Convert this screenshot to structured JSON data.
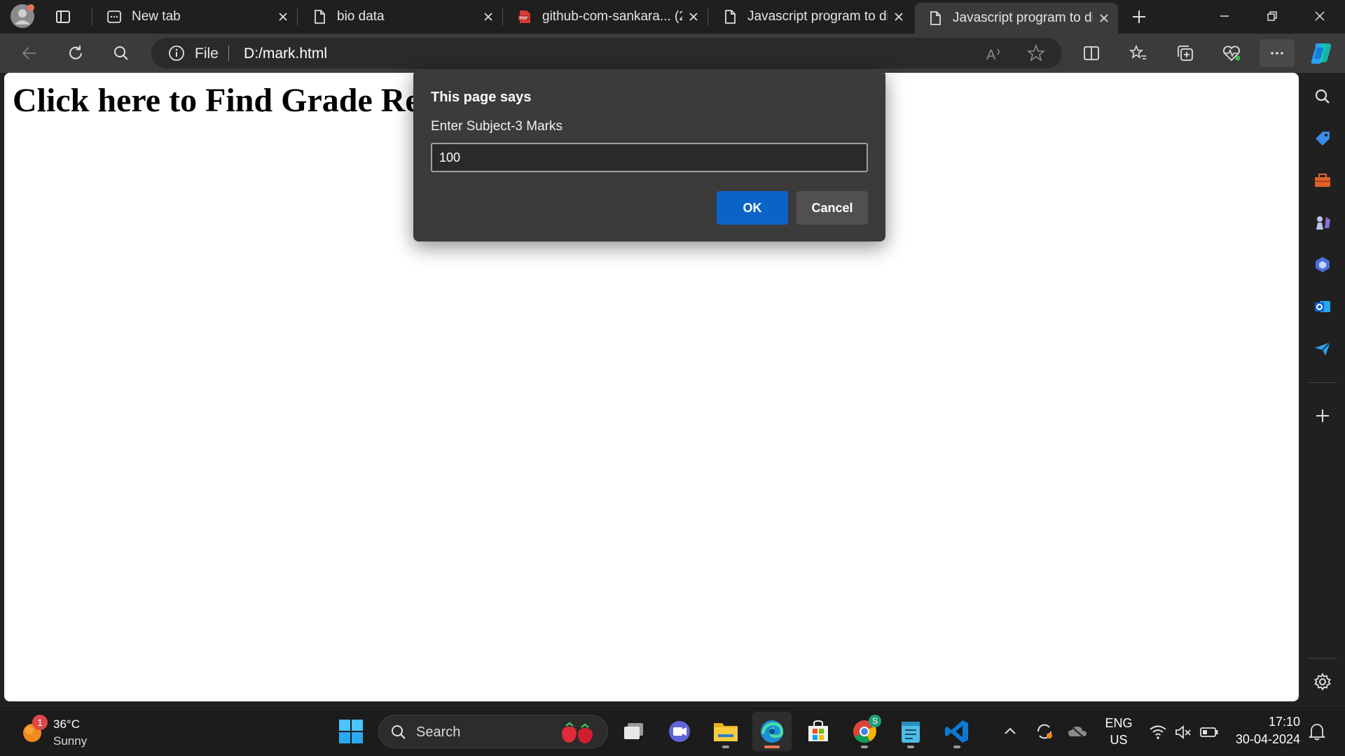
{
  "browser": {
    "tabs": [
      {
        "title": "New tab",
        "icon": "new-tab-icon",
        "active": false
      },
      {
        "title": "bio data",
        "icon": "file-icon",
        "active": false
      },
      {
        "title": "github-com-sankara... (2",
        "icon": "pdf-icon",
        "active": false
      },
      {
        "title": "Javascript program to di",
        "icon": "file-icon",
        "active": false
      },
      {
        "title": "Javascript program to di",
        "icon": "file-icon",
        "active": true
      }
    ],
    "address": {
      "scheme": "File",
      "url": "D:/mark.html"
    }
  },
  "page": {
    "heading": "Click here to Find Grade Re"
  },
  "dialog": {
    "title": "This page says",
    "message": "Enter Subject-3 Marks",
    "input_value": "100",
    "ok_label": "OK",
    "cancel_label": "Cancel"
  },
  "taskbar": {
    "weather": {
      "temp": "36°C",
      "condition": "Sunny",
      "badge": "1"
    },
    "search_label": "Search",
    "chrome_badge": "S",
    "tray": {
      "lang": "ENG",
      "region": "US",
      "time": "17:10",
      "date": "30-04-2024"
    }
  },
  "colors": {
    "accent": "#0a64c8",
    "dialog_bg": "#3b3b3b",
    "toolbar_bg": "#3b3b3b",
    "titlebar_bg": "#1f1f1f"
  }
}
